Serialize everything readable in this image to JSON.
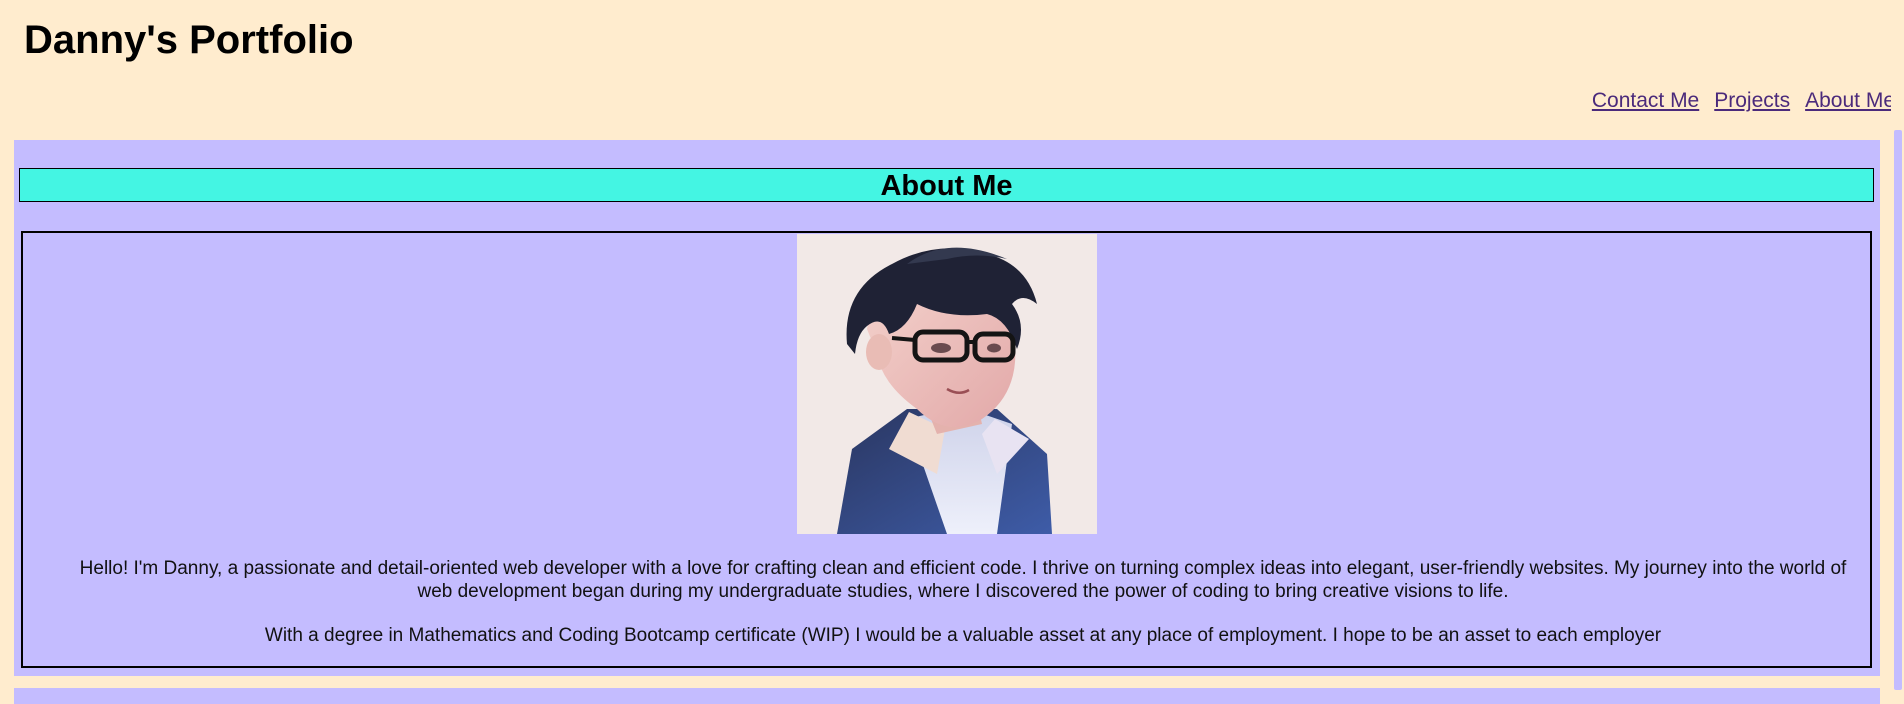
{
  "header": {
    "title": "Danny's Portfolio"
  },
  "nav": {
    "items": [
      {
        "label": "Contact Me"
      },
      {
        "label": "Projects"
      },
      {
        "label": "About Me"
      }
    ]
  },
  "about": {
    "heading": "About Me",
    "paragraphs": [
      "Hello! I'm Danny, a passionate and detail-oriented web developer with a love for crafting clean and efficient code. I thrive on turning complex ideas into elegant, user-friendly websites. My journey into the world of web development began during my undergraduate studies, where I discovered the power of coding to bring creative visions to life.",
      "With a degree in Mathematics and Coding Bootcamp certificate (WIP) I would be a valuable asset at any place of employment. I hope to be an asset to each employer"
    ]
  },
  "colors": {
    "page_background": "#ffecce",
    "section_background": "#c4bcff",
    "heading_background": "#44f5e3",
    "link": "#4b2a7b"
  }
}
